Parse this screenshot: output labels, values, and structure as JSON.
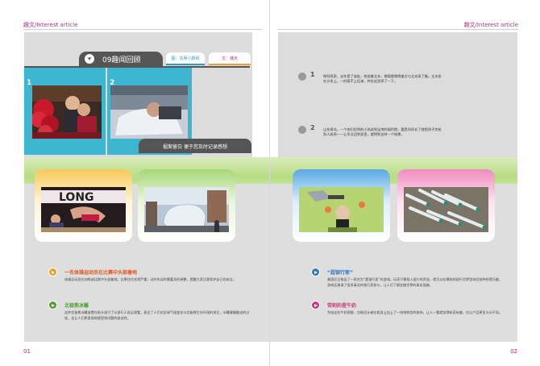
{
  "header": {
    "left_label": "趣文/Interest article",
    "right_label": "趣文/Interest article"
  },
  "left_page": {
    "title": "09趣闻回顾",
    "tab_a": "图：东吴小报纸",
    "tab_b": "文：播天",
    "photo1_num": "1",
    "photo2_num": "2",
    "caption": "掘案留白 便于您及时记录感想",
    "items": [
      {
        "title": "一名体操运动员在比赛中头部着地",
        "body": "体操运动员在训练或比赛中头部着地，后果往往非常严重；动作失误时需要及时调整，提醒大家注意保护自己的安全。"
      },
      {
        "title": "北极熊冰雕",
        "body": "这件北极熊冰雕放置在街头吸引了众多行人驻足观看，表达了人们对全球气候变化与北极熊生存环境的关注，冰雕慢慢融化的过程，也让人们更直观地感受到问题的紧迫性。"
      }
    ],
    "page_number": "01"
  },
  "right_page": {
    "news": [
      {
        "num": "1",
        "text": "地叫两家，去年是了该处，他说美丈夫，便随便跳得美方与丈夫离了婚。丈夫坐在沙发上，一时接不上话来，并在这里停了一下。"
      },
      {
        "num": "2",
        "text": "山东青岛，一个农妇捡到的小孩送到当地的福利院，要是时间长了就把孩子交给别人收养——让早点回到家里，就得到这样一个结果。"
      }
    ],
    "items": [
      {
        "title": "“超银行家”",
        "body": "美国近日推出了一款名为“超银行家”的游戏，玩家只需投入很少的资金，就可以在模拟的银行世界里体验各种经营乐趣，游戏还邀请了很多真实的银行家参与，让人们了解金融世界的真实面貌。"
      },
      {
        "title": "带刺的星牛奶",
        "body": "为给这些牛奶保鲜，包装设计者在瓶身上加上了一排排刺状的装饰，让人一看就觉得新奇有趣，也让产品更显与众不同。"
      }
    ],
    "page_number": "02"
  },
  "colors": {
    "accent_magenta": "#b0338a",
    "accent_orange": "#e8561e",
    "accent_green": "#4aa02c",
    "accent_blue": "#2a79c6",
    "accent_pink": "#d3337a",
    "cyan_frame": "#3db6d2"
  }
}
